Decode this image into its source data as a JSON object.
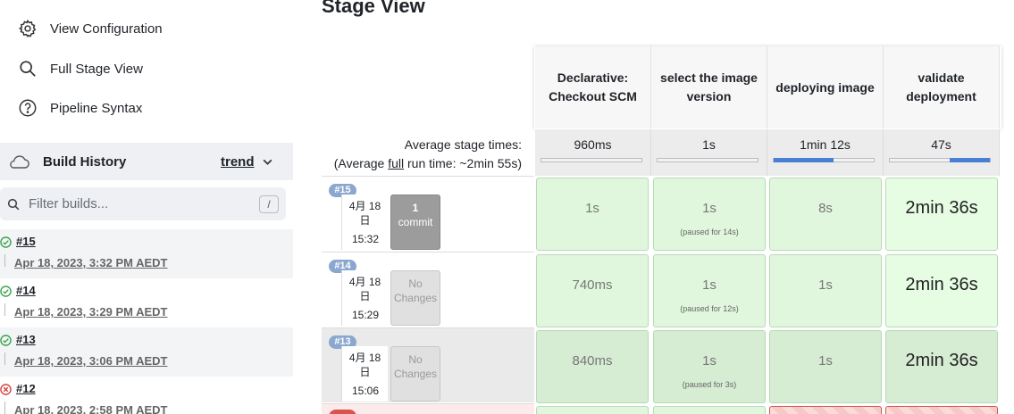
{
  "sidebar": {
    "links": [
      {
        "label": "View Configuration",
        "icon": "gear-icon"
      },
      {
        "label": "Full Stage View",
        "icon": "search-icon"
      },
      {
        "label": "Pipeline Syntax",
        "icon": "help-icon"
      }
    ],
    "build_history": {
      "title": "Build History",
      "trend_label": "trend",
      "filter_placeholder": "Filter builds...",
      "filter_shortcut": "/",
      "builds": [
        {
          "number": "#15",
          "date": "Apr 18, 2023, 3:32 PM AEDT",
          "status": "success"
        },
        {
          "number": "#14",
          "date": "Apr 18, 2023, 3:29 PM AEDT",
          "status": "success"
        },
        {
          "number": "#13",
          "date": "Apr 18, 2023, 3:06 PM AEDT",
          "status": "success"
        },
        {
          "number": "#12",
          "date": "Apr 18, 2023, 2:58 PM AEDT",
          "status": "failed"
        }
      ]
    }
  },
  "stage_view": {
    "title": "Stage View",
    "average_label": "Average stage times:",
    "full_run_prefix": "(Average ",
    "full_run_link": "full",
    "full_run_suffix": " run time: ~2min 55s)",
    "stages": [
      {
        "name": "Declarative: Checkout SCM",
        "avg": "960ms",
        "avg_fraction": 0.0
      },
      {
        "name": "select the image version",
        "avg": "1s",
        "avg_fraction": 0.0
      },
      {
        "name": "deploying image",
        "avg": "1min 12s",
        "avg_fraction": 0.6
      },
      {
        "name": "validate deployment",
        "avg": "47s",
        "avg_fraction": 0.4
      }
    ],
    "runs": [
      {
        "badge": "#15",
        "date_line1": "4月 18",
        "date_line2": "日",
        "time": "15:32",
        "changes_line1": "1",
        "changes_line2": "commit",
        "cells": [
          {
            "value": "1s",
            "paused": ""
          },
          {
            "value": "1s",
            "paused": "(paused for 14s)"
          },
          {
            "value": "8s",
            "paused": ""
          },
          {
            "value": "2min 36s",
            "paused": ""
          }
        ]
      },
      {
        "badge": "#14",
        "date_line1": "4月 18",
        "date_line2": "日",
        "time": "15:29",
        "changes_line1": "No",
        "changes_line2": "Changes",
        "cells": [
          {
            "value": "740ms",
            "paused": ""
          },
          {
            "value": "1s",
            "paused": "(paused for 12s)"
          },
          {
            "value": "1s",
            "paused": ""
          },
          {
            "value": "2min 36s",
            "paused": ""
          }
        ]
      },
      {
        "badge": "#13",
        "date_line1": "4月 18",
        "date_line2": "日",
        "time": "15:06",
        "changes_line1": "No",
        "changes_line2": "Changes",
        "cells": [
          {
            "value": "840ms",
            "paused": ""
          },
          {
            "value": "1s",
            "paused": "(paused for 3s)"
          },
          {
            "value": "1s",
            "paused": ""
          },
          {
            "value": "2min 36s",
            "paused": ""
          }
        ]
      }
    ]
  },
  "colors": {
    "success": "#2e9e44",
    "failed": "#d33833",
    "stage_bg": "#e1f7dd",
    "accent": "#4a7fd6"
  }
}
